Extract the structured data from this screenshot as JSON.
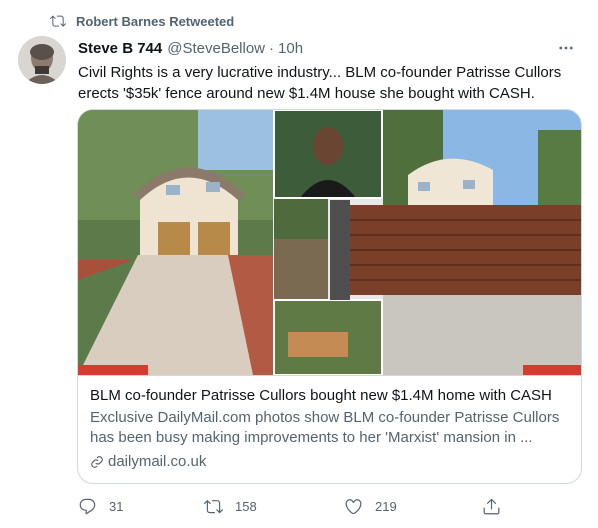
{
  "retweet": {
    "label": "Robert Barnes Retweeted"
  },
  "author": {
    "name": "Steve B 744",
    "handle": "@SteveBellow",
    "separator": "·",
    "time": "10h"
  },
  "tweet": {
    "text": "Civil Rights is a very lucrative industry... BLM co-founder Patrisse Cullors erects '$35k' fence around new $1.4M house she bought with CASH."
  },
  "card": {
    "title": "BLM co-founder Patrisse Cullors bought new $1.4M home with CASH",
    "description": "Exclusive DailyMail.com photos show BLM co-founder Patrisse Cullors has been busy making improvements to her 'Marxist' mansion in ...",
    "domain": "dailymail.co.uk"
  },
  "actions": {
    "replies": "31",
    "retweets": "158",
    "likes": "219"
  },
  "icons": {
    "retweet": "retweet-icon",
    "more": "more-icon",
    "reply": "reply-icon",
    "like": "heart-icon",
    "share": "share-icon",
    "link": "link-icon"
  },
  "colors": {
    "text": "#0f1419",
    "secondary": "#536471",
    "border": "#cfd9de"
  }
}
